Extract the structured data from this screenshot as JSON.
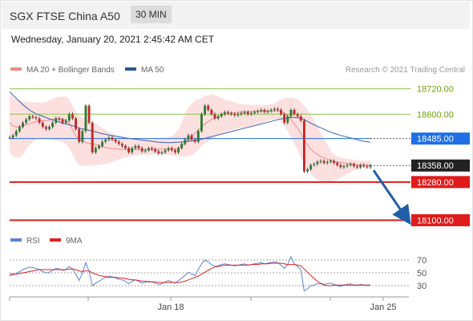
{
  "header": {
    "title": "SGX FTSE China A50",
    "timeframe": "30 MIN"
  },
  "timestamp": "Wednesday, January 20, 2021 2:45:42 AM CET",
  "copyright": "Research © 2021 Trading Central",
  "legend": [
    {
      "label": "MA 20 + Bollinger Bands",
      "color": "#ef8a8a"
    },
    {
      "label": "MA 50",
      "color": "#2b5797"
    }
  ],
  "rsi_legend": [
    {
      "label": "RSI",
      "color": "#5a85d6"
    },
    {
      "label": "9MA",
      "color": "#e02020"
    }
  ],
  "chart_data": [
    {
      "type": "candlestick",
      "ylim": [
        18060,
        18760
      ],
      "x_ticks": [
        "Jan 18",
        "Jan 25"
      ],
      "levels": [
        {
          "value": 18720,
          "label": "18720.00",
          "kind": "resistance",
          "color": "#8bc34a"
        },
        {
          "value": 18600,
          "label": "18600.00",
          "kind": "resistance",
          "color": "#8bc34a"
        },
        {
          "value": 18485,
          "label": "18485.00",
          "kind": "pivot",
          "color": "#1f6fe6"
        },
        {
          "value": 18358,
          "label": "18358.00",
          "kind": "last-price",
          "color": "#222222"
        },
        {
          "value": 18280,
          "label": "18280.00",
          "kind": "support",
          "color": "#e01b1b"
        },
        {
          "value": 18100,
          "label": "18100.00",
          "kind": "support",
          "color": "#e01b1b"
        }
      ],
      "close": [
        18490,
        18500,
        18520,
        18540,
        18560,
        18575,
        18590,
        18585,
        18580,
        18560,
        18540,
        18530,
        18540,
        18560,
        18580,
        18575,
        18560,
        18570,
        18600,
        18580,
        18530,
        18470,
        18520,
        18640,
        18560,
        18420,
        18440,
        18450,
        18470,
        18480,
        18490,
        18480,
        18470,
        18460,
        18450,
        18440,
        18420,
        18440,
        18450,
        18440,
        18425,
        18430,
        18440,
        18435,
        18425,
        18415,
        18420,
        18430,
        18440,
        18430,
        18420,
        18440,
        18460,
        18480,
        18500,
        18480,
        18470,
        18520,
        18600,
        18640,
        18620,
        18600,
        18580,
        18590,
        18600,
        18610,
        18605,
        18600,
        18595,
        18600,
        18605,
        18610,
        18600,
        18605,
        18610,
        18615,
        18620,
        18610,
        18615,
        18620,
        18625,
        18620,
        18600,
        18560,
        18590,
        18620,
        18600,
        18590,
        18570,
        18330,
        18340,
        18360,
        18365,
        18375,
        18380,
        18370,
        18375,
        18380,
        18370,
        18360,
        18350,
        18355,
        18360,
        18365,
        18355,
        18350,
        18360,
        18355,
        18350,
        18358
      ],
      "bb_upper": [
        18690,
        18680,
        18670,
        18665,
        18660,
        18660,
        18658,
        18655,
        18655,
        18655,
        18655,
        18658,
        18665,
        18672,
        18680,
        18682,
        18684,
        18682,
        18670,
        18640,
        18610,
        18595,
        18585,
        18575,
        18565,
        18560,
        18555,
        18545,
        18535,
        18525,
        18515,
        18508,
        18500,
        18496,
        18492,
        18490,
        18488,
        18487,
        18486,
        18485,
        18485,
        18484,
        18484,
        18483,
        18483,
        18484,
        18484,
        18487,
        18492,
        18498,
        18510,
        18530,
        18560,
        18600,
        18630,
        18650,
        18665,
        18670,
        18675,
        18685,
        18690,
        18695,
        18690,
        18685,
        18678,
        18670,
        18665,
        18660,
        18655,
        18650,
        18648,
        18646,
        18645,
        18644,
        18643,
        18643,
        18642,
        18643,
        18645,
        18648,
        18650,
        18660,
        18670,
        18675,
        18678,
        18678,
        18675,
        18670,
        18655,
        18640,
        18620,
        18595,
        18570,
        18545,
        18515,
        18485,
        18455,
        18430,
        18410,
        18400,
        18395,
        18392,
        18390,
        18388,
        18385,
        18383,
        18381,
        18380,
        18380,
        18380
      ],
      "bb_lower": [
        18420,
        18400,
        18395,
        18395,
        18410,
        18435,
        18455,
        18470,
        18480,
        18485,
        18486,
        18486,
        18484,
        18480,
        18476,
        18472,
        18468,
        18460,
        18440,
        18410,
        18380,
        18360,
        18355,
        18355,
        18356,
        18358,
        18360,
        18362,
        18364,
        18366,
        18370,
        18374,
        18380,
        18386,
        18392,
        18397,
        18400,
        18402,
        18404,
        18406,
        18407,
        18408,
        18409,
        18410,
        18411,
        18412,
        18412,
        18410,
        18408,
        18405,
        18402,
        18400,
        18400,
        18402,
        18404,
        18406,
        18420,
        18435,
        18450,
        18462,
        18472,
        18480,
        18490,
        18500,
        18508,
        18515,
        18520,
        18524,
        18528,
        18532,
        18535,
        18537,
        18540,
        18545,
        18550,
        18555,
        18560,
        18565,
        18570,
        18575,
        18578,
        18575,
        18565,
        18545,
        18520,
        18492,
        18462,
        18430,
        18398,
        18368,
        18340,
        18318,
        18300,
        18290,
        18284,
        18281,
        18280,
        18282,
        18286,
        18292,
        18300,
        18310,
        18320,
        18328,
        18335,
        18340,
        18344,
        18348,
        18350,
        18352
      ],
      "ma20": [
        18560,
        18545,
        18540,
        18540,
        18545,
        18550,
        18555,
        18560,
        18565,
        18568,
        18570,
        18570,
        18572,
        18576,
        18579,
        18578,
        18576,
        18572,
        18556,
        18528,
        18498,
        18480,
        18472,
        18466,
        18462,
        18460,
        18457,
        18452,
        18447,
        18443,
        18440,
        18438,
        18436,
        18435,
        18434,
        18434,
        18434,
        18434,
        18434,
        18434,
        18434,
        18434,
        18434,
        18434,
        18434,
        18435,
        18436,
        18436,
        18436,
        18436,
        18436,
        18440,
        18450,
        18465,
        18480,
        18495,
        18510,
        18525,
        18540,
        18555,
        18565,
        18575,
        18582,
        18588,
        18594,
        18600,
        18603,
        18605,
        18607,
        18609,
        18611,
        18612,
        18612,
        18612,
        18613,
        18613,
        18614,
        18614,
        18614,
        18615,
        18616,
        18616,
        18614,
        18606,
        18592,
        18575,
        18555,
        18535,
        18510,
        18480,
        18455,
        18435,
        18420,
        18410,
        18400,
        18394,
        18388,
        18382,
        18378,
        18374,
        18372,
        18370,
        18368,
        18366,
        18364,
        18362,
        18360,
        18360,
        18360,
        18360
      ],
      "ma50": [
        18705,
        18690,
        18675,
        18660,
        18645,
        18632,
        18620,
        18610,
        18602,
        18596,
        18590,
        18584,
        18578,
        18573,
        18568,
        18563,
        18558,
        18554,
        18550,
        18546,
        18540,
        18534,
        18530,
        18528,
        18524,
        18520,
        18516,
        18512,
        18508,
        18505,
        18502,
        18499,
        18496,
        18494,
        18491,
        18488,
        18486,
        18484,
        18482,
        18480,
        18478,
        18476,
        18474,
        18472,
        18470,
        18468,
        18467,
        18466,
        18466,
        18466,
        18467,
        18468,
        18469,
        18470,
        18472,
        18474,
        18476,
        18478,
        18482,
        18486,
        18490,
        18494,
        18498,
        18502,
        18506,
        18510,
        18514,
        18518,
        18522,
        18526,
        18530,
        18534,
        18538,
        18542,
        18546,
        18550,
        18554,
        18558,
        18562,
        18566,
        18570,
        18574,
        18578,
        18580,
        18582,
        18584,
        18584,
        18583,
        18581,
        18575,
        18566,
        18558,
        18550,
        18543,
        18536,
        18529,
        18522,
        18515,
        18510,
        18505,
        18500,
        18496,
        18492,
        18488,
        18484,
        18480,
        18476,
        18472,
        18470,
        18468
      ],
      "projection": {
        "from": 18358,
        "to": 18100
      }
    },
    {
      "type": "line",
      "name": "RSI",
      "ylim": [
        15,
        85
      ],
      "y_ticks": [
        70,
        50,
        30
      ],
      "series": [
        {
          "name": "RSI",
          "values": [
            45,
            47,
            49,
            52,
            55,
            57,
            59,
            58,
            57,
            55,
            52,
            50,
            51,
            54,
            57,
            56,
            54,
            55,
            60,
            56,
            48,
            38,
            50,
            66,
            52,
            30,
            34,
            37,
            40,
            43,
            45,
            44,
            42,
            40,
            39,
            37,
            33,
            37,
            39,
            37,
            34,
            35,
            37,
            36,
            34,
            32,
            33,
            36,
            38,
            36,
            34,
            38,
            42,
            46,
            51,
            48,
            46,
            55,
            64,
            70,
            67,
            63,
            60,
            61,
            63,
            64,
            63,
            62,
            61,
            62,
            63,
            64,
            62,
            63,
            64,
            65,
            66,
            64,
            65,
            66,
            67,
            66,
            62,
            57,
            63,
            75,
            64,
            60,
            55,
            22,
            25,
            30,
            31,
            33,
            34,
            32,
            33,
            34,
            32,
            30,
            29,
            31,
            32,
            33,
            31,
            30,
            32,
            31,
            30,
            31
          ]
        },
        {
          "name": "9MA",
          "values": [
            48,
            48,
            48,
            49,
            50,
            51,
            52,
            53,
            54,
            55,
            55,
            55,
            55,
            55,
            55,
            55,
            55,
            55,
            56,
            56,
            55,
            53,
            52,
            53,
            53,
            50,
            48,
            46,
            45,
            44,
            43,
            43,
            43,
            42,
            42,
            41,
            40,
            39,
            39,
            38,
            37,
            37,
            36,
            36,
            36,
            35,
            35,
            35,
            35,
            35,
            35,
            35,
            36,
            37,
            39,
            41,
            43,
            45,
            48,
            51,
            54,
            57,
            59,
            60,
            61,
            62,
            62,
            62,
            62,
            62,
            62,
            62,
            62,
            63,
            63,
            63,
            64,
            64,
            64,
            65,
            65,
            65,
            65,
            64,
            63,
            63,
            63,
            62,
            61,
            56,
            51,
            46,
            41,
            37,
            33,
            31,
            30,
            30,
            31,
            31,
            31,
            31,
            31,
            31,
            31,
            31,
            31,
            31,
            31,
            31
          ]
        }
      ]
    }
  ]
}
